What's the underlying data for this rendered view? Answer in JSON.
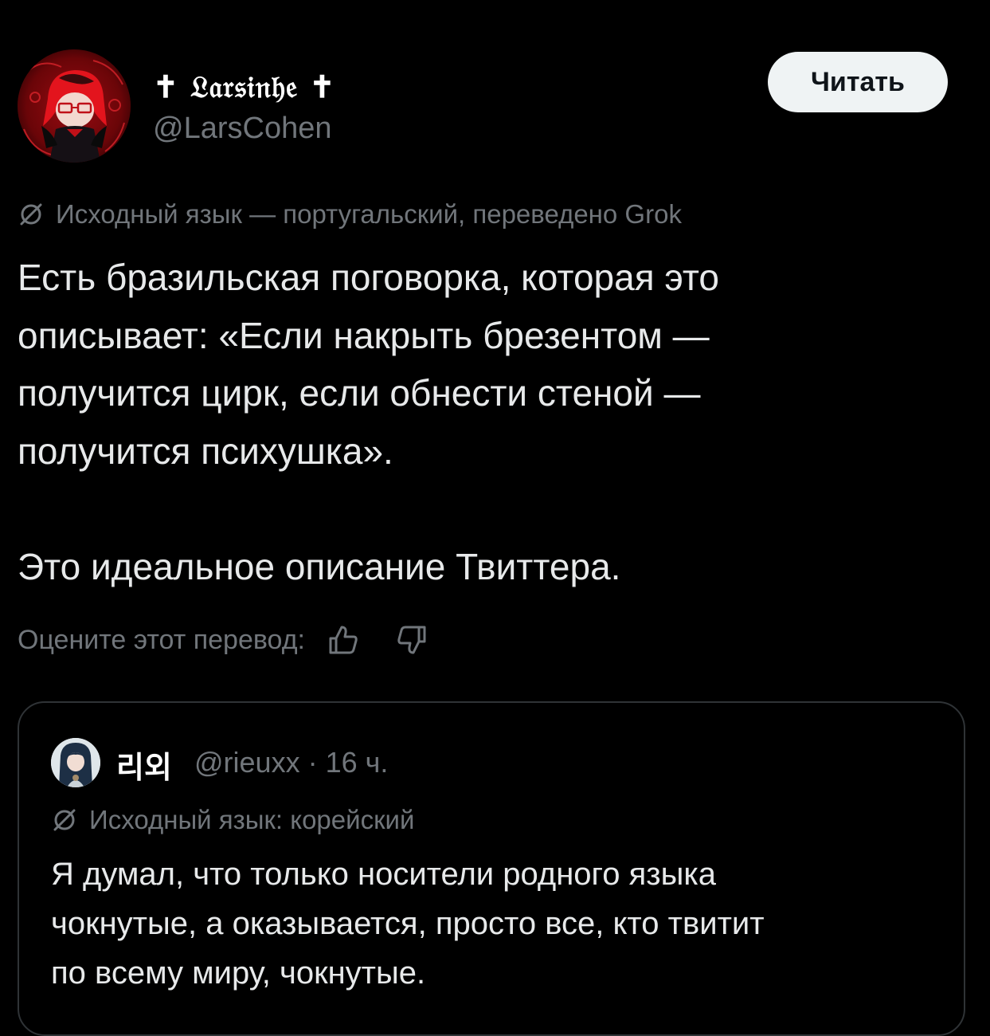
{
  "post": {
    "display_name": "✝ 𝔏𝔞𝔯𝔰𝔦𝔫𝔥𝔢 ✝",
    "handle": "@LarsCohen",
    "follow_label": "Читать",
    "translation_note": "Исходный язык — португальский, переведено Grok",
    "text_lines": [
      "Есть бразильская поговорка, которая это",
      "описывает: «Если накрыть брезентом —",
      "получится цирк, если обнести стеной —",
      "получится психушка»."
    ],
    "text_last": "Это идеальное описание Твиттера.",
    "rate_label": "Оцените этот перевод:",
    "icons": {
      "avatar": "avatar-image",
      "translate": "translate-icon",
      "like": "thumbs-up-icon",
      "dislike": "thumbs-down-icon"
    }
  },
  "quote": {
    "name": "리외",
    "meta": "@rieuxx · 16 ч.",
    "translation_note": "Исходный язык: корейский",
    "text_lines": [
      "Я думал, что только носители родного языка",
      "чокнутые, а оказывается, просто все, кто твитит",
      "по всему миру, чокнутые."
    ]
  },
  "colors": {
    "background": "#000000",
    "text": "#e7e9ea",
    "muted": "#71767b",
    "border": "#2f3336",
    "button_bg": "#eff3f4",
    "avatar_red": "#c0121a"
  }
}
